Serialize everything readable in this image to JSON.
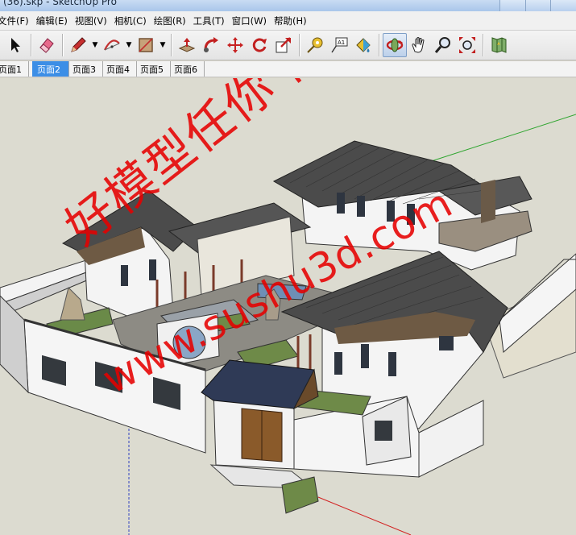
{
  "window": {
    "title": "(36).skp - SketchUp Pro"
  },
  "menu": [
    {
      "label": "文件(F)"
    },
    {
      "label": "编辑(E)"
    },
    {
      "label": "视图(V)"
    },
    {
      "label": "相机(C)"
    },
    {
      "label": "绘图(R)"
    },
    {
      "label": "工具(T)"
    },
    {
      "label": "窗口(W)"
    },
    {
      "label": "帮助(H)"
    }
  ],
  "toolbar": [
    {
      "icon": "select-arrow-icon"
    },
    {
      "icon": "eraser-icon"
    },
    {
      "icon": "pencil-line-icon"
    },
    {
      "icon": "arc-icon"
    },
    {
      "icon": "rectangle-icon"
    },
    {
      "icon": "push-pull-icon"
    },
    {
      "icon": "follow-me-icon"
    },
    {
      "icon": "move-icon"
    },
    {
      "icon": "rotate-icon"
    },
    {
      "icon": "scale-icon"
    },
    {
      "icon": "tape-measure-icon"
    },
    {
      "icon": "text-label-icon",
      "text": "A1"
    },
    {
      "icon": "paint-bucket-icon"
    },
    {
      "icon": "orbit-icon",
      "active": true
    },
    {
      "icon": "pan-hand-icon"
    },
    {
      "icon": "zoom-icon"
    },
    {
      "icon": "zoom-extents-icon"
    },
    {
      "icon": "map-icon"
    }
  ],
  "scene_tabs": [
    {
      "label": "页面1",
      "selected": false
    },
    {
      "label": "页面2",
      "selected": true
    },
    {
      "label": "页面3",
      "selected": false
    },
    {
      "label": "页面4",
      "selected": false
    },
    {
      "label": "页面5",
      "selected": false
    },
    {
      "label": "页面6",
      "selected": false
    }
  ],
  "viewport": {
    "watermark_cn": "好模型任你下",
    "watermark_url": "www.sushu3d.com",
    "colors": {
      "background": "#dcdbd0",
      "roof": "#4a4a4a",
      "wall": "#f4f4f4",
      "watermark": "#e60000"
    }
  }
}
